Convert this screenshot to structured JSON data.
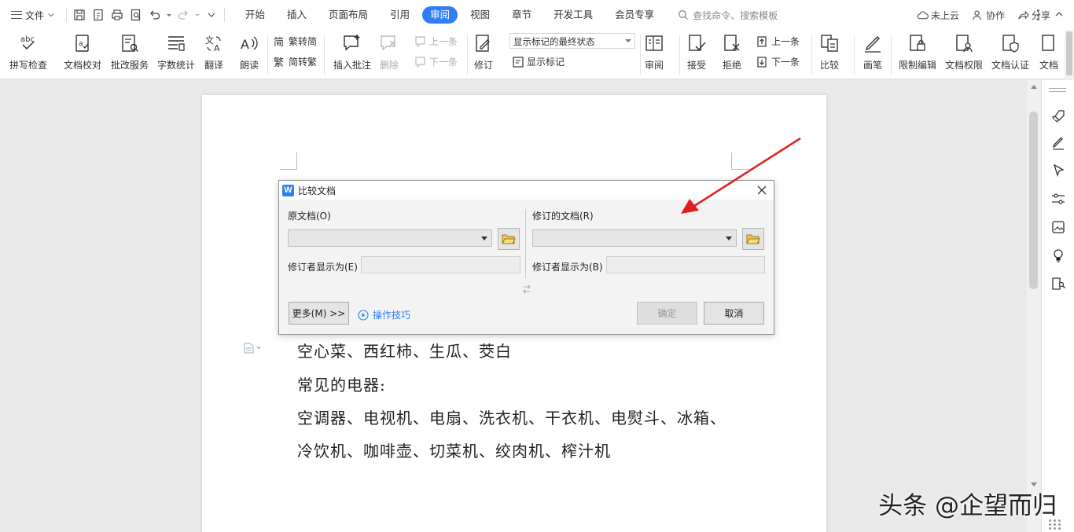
{
  "menubar": {
    "file_label": "文件",
    "tabs": [
      {
        "label": "开始"
      },
      {
        "label": "插入"
      },
      {
        "label": "页面布局"
      },
      {
        "label": "引用"
      },
      {
        "label": "审阅",
        "active": true
      },
      {
        "label": "视图"
      },
      {
        "label": "章节"
      },
      {
        "label": "开发工具"
      },
      {
        "label": "会员专享"
      }
    ],
    "search_placeholder": "查找命令、搜索模板",
    "cloud_label": "未上云",
    "collab_label": "协作",
    "share_label": "分享",
    "accent_color": "#2f7ef5"
  },
  "ribbon": {
    "spellcheck": "拼写检查",
    "doc_proof": "文档校对",
    "correction_service": "批改服务",
    "word_count": "字数统计",
    "translate": "翻译",
    "read_aloud": "朗读",
    "trad_conv": "繁转简",
    "simp_conv": "简转繁",
    "insert_comment": "插入批注",
    "delete": "删除",
    "prev_item": "上一条",
    "next_item": "下一条",
    "revise": "修订",
    "markup_state": "显示标记的最终状态",
    "show_markup": "显示标记",
    "review": "审阅",
    "accept": "接受",
    "reject": "拒绝",
    "prev_change": "上一条",
    "next_change": "下一条",
    "compare": "比较",
    "pen": "画笔",
    "restrict_edit": "限制编辑",
    "doc_permission": "文档权限",
    "doc_cert": "文档认证",
    "doc_extra": "文档"
  },
  "document": {
    "lines": [
      "空心菜、西红柿、生瓜、茭白",
      "常见的电器:",
      "空调器、电视机、电扇、洗衣机、干衣机、电熨斗、冰箱、",
      "冷饮机、咖啡壶、切菜机、绞肉机、榨汁机"
    ]
  },
  "dialog": {
    "title": "比较文档",
    "logo": "W",
    "original_label": "原文档(O)",
    "revised_label": "修订的文档(R)",
    "original_author_label": "修订者显示为(E)",
    "revised_author_label": "修订者显示为(B)",
    "original_value": "",
    "revised_value": "",
    "more_button": "更多(M) >>",
    "tips_link": "操作技巧",
    "ok_button": "确定",
    "cancel_button": "取消"
  },
  "side_panel": {
    "icons": [
      "rocket-icon",
      "pen-icon",
      "cursor-icon",
      "sliders-icon",
      "image-icon",
      "lightbulb-icon",
      "book-search-icon"
    ]
  },
  "watermark": "头条 @企望而归",
  "annotation_color": "#e02020"
}
